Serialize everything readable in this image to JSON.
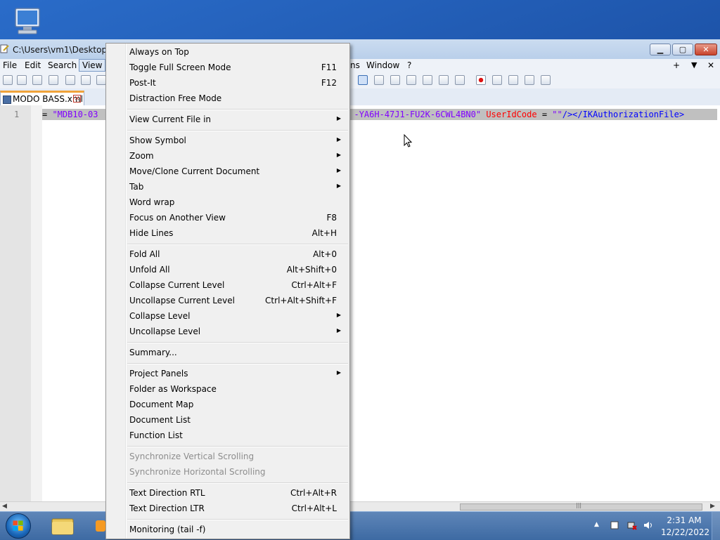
{
  "window": {
    "title": "C:\\Users\\vm1\\Desktop\\M",
    "min_glyph": "▁",
    "max_glyph": "▢",
    "close_glyph": "✕"
  },
  "menubar": {
    "file": "File",
    "edit": "Edit",
    "search": "Search",
    "view": "View",
    "plugins_tail": "ns",
    "window": "Window",
    "help": "?",
    "plus": "+",
    "down": "▼",
    "close": "✕"
  },
  "tab": {
    "label": "MODO BASS.xml",
    "close": "✕"
  },
  "editor": {
    "line_number": "1",
    "seg1": "= ",
    "seg2": "\"MDB10-03",
    "seg3": "-YA6H-47J1-FU2K-6CWL4BN0\"",
    "seg4": " UserIdCode",
    "seg5": " = ",
    "seg6": "\"\"",
    "seg7": "/></IKAuthorizationFile>"
  },
  "scroll": {
    "left_arrow": "◀",
    "right_arrow": "▶",
    "thumb_grip": "|||"
  },
  "view_menu": {
    "items": [
      {
        "label": "Always on Top",
        "accel": ""
      },
      {
        "label": "Toggle Full Screen Mode",
        "accel": "F11"
      },
      {
        "label": "Post-It",
        "accel": "F12"
      },
      {
        "label": "Distraction Free Mode",
        "accel": ""
      },
      {
        "label": "View Current File in",
        "accel": ""
      },
      {
        "label": "Show Symbol",
        "accel": ""
      },
      {
        "label": "Zoom",
        "accel": ""
      },
      {
        "label": "Move/Clone Current Document",
        "accel": ""
      },
      {
        "label": "Tab",
        "accel": ""
      },
      {
        "label": "Word wrap",
        "accel": ""
      },
      {
        "label": "Focus on Another View",
        "accel": "F8"
      },
      {
        "label": "Hide Lines",
        "accel": "Alt+H"
      },
      {
        "label": "Fold All",
        "accel": "Alt+0"
      },
      {
        "label": "Unfold All",
        "accel": "Alt+Shift+0"
      },
      {
        "label": "Collapse Current Level",
        "accel": "Ctrl+Alt+F"
      },
      {
        "label": "Uncollapse Current Level",
        "accel": "Ctrl+Alt+Shift+F"
      },
      {
        "label": "Collapse Level",
        "accel": ""
      },
      {
        "label": "Uncollapse Level",
        "accel": ""
      },
      {
        "label": "Summary...",
        "accel": ""
      },
      {
        "label": "Project Panels",
        "accel": ""
      },
      {
        "label": "Folder as Workspace",
        "accel": ""
      },
      {
        "label": "Document Map",
        "accel": ""
      },
      {
        "label": "Document List",
        "accel": ""
      },
      {
        "label": "Function List",
        "accel": ""
      },
      {
        "label": "Synchronize Vertical Scrolling",
        "accel": ""
      },
      {
        "label": "Synchronize Horizontal Scrolling",
        "accel": ""
      },
      {
        "label": "Text Direction RTL",
        "accel": "Ctrl+Alt+R"
      },
      {
        "label": "Text Direction LTR",
        "accel": "Ctrl+Alt+L"
      },
      {
        "label": "Monitoring (tail -f)",
        "accel": ""
      }
    ],
    "submenu_arrow": "▶"
  },
  "taskbar": {
    "time": "2:31 AM",
    "date": "12/22/2022",
    "tray_arrow": "▲"
  },
  "colors": {
    "xml_value": "#8000ff",
    "xml_attribute": "#ff0000",
    "xml_tag": "#0000ff",
    "tab_accent": "#f0a33a",
    "disabled_text": "#8d8d8d"
  }
}
